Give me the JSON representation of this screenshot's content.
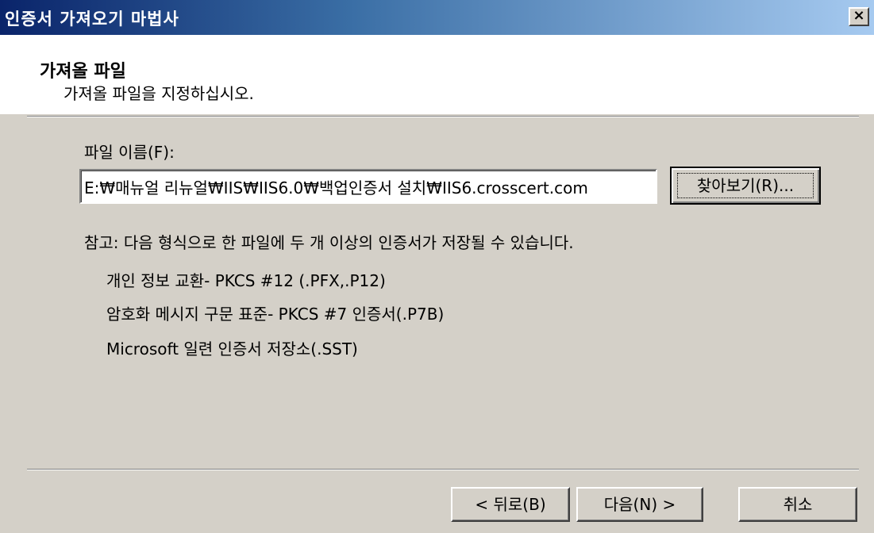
{
  "window": {
    "title": "인증서 가져오기 마법사",
    "close_label": "×"
  },
  "header": {
    "title": "가져올 파일",
    "subtitle": "가져올 파일을 지정하십시오."
  },
  "file": {
    "label": "파일 이름(F):",
    "value": "E:₩매뉴얼 리뉴얼₩IIS₩IIS6.0₩백업인증서 설치₩IIS6.crosscert.com",
    "browse_label": "찾아보기(R)..."
  },
  "note": {
    "text": "참고: 다음 형식으로 한 파일에 두 개 이상의 인증서가 저장될 수 있습니다.",
    "formats": [
      "개인 정보 교환- PKCS #12 (.PFX,.P12)",
      "암호화 메시지 구문 표준- PKCS #7 인증서(.P7B)",
      "Microsoft 일련 인증서 저장소(.SST)"
    ]
  },
  "footer": {
    "back_label": "< 뒤로(B)",
    "next_label": "다음(N) >",
    "cancel_label": "취소"
  }
}
